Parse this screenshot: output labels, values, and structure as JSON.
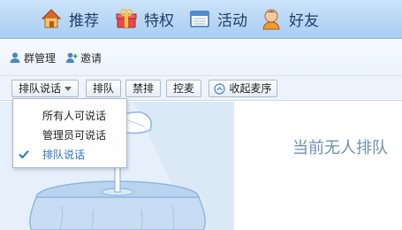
{
  "topnav": {
    "items": [
      {
        "label": "推荐",
        "icon": "home-icon"
      },
      {
        "label": "特权",
        "icon": "gift-icon"
      },
      {
        "label": "活动",
        "icon": "calendar-icon"
      },
      {
        "label": "好友",
        "icon": "friend-avatar-icon"
      }
    ]
  },
  "subbar": {
    "group_manage": "群管理",
    "invite": "邀请"
  },
  "toolbar": {
    "queue_mode": "排队说话",
    "queue": "排队",
    "mute_queue": "禁排",
    "grab_mic": "控麦",
    "collapse_mic_queue": "收起麦序"
  },
  "dropdown": {
    "options": [
      {
        "label": "所有人可说话",
        "selected": false
      },
      {
        "label": "管理员可说话",
        "selected": false
      },
      {
        "label": "排队说话",
        "selected": true
      }
    ]
  },
  "main": {
    "empty_message": "当前无人排队"
  },
  "colors": {
    "nav_bg": "#b7d6f5",
    "accent_blue": "#2a72c0",
    "empty_text": "#6d8fb3"
  }
}
